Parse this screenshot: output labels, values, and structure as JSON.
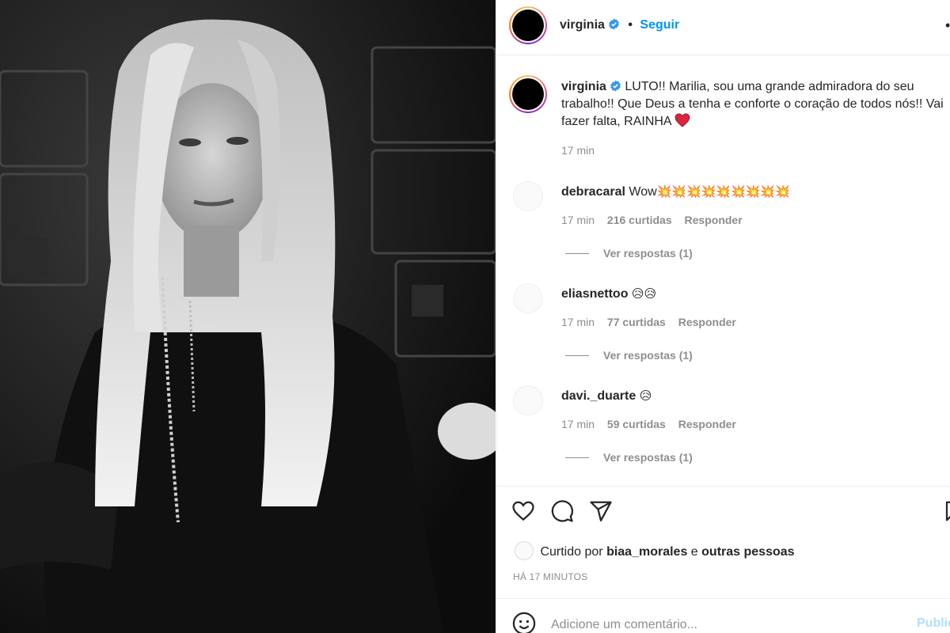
{
  "header": {
    "username": "virginia",
    "separator": "•",
    "follow_label": "Seguir",
    "more": "•"
  },
  "caption": {
    "username": "virginia",
    "text": "LUTO!! Marilia, sou uma grande admiradora do seu trabalho!! Que Deus a tenha e conforte o coração de todos nós!! Vai fazer falta, RAINHA",
    "emoji": "red-heart",
    "time": "17 min"
  },
  "comments": [
    {
      "username": "debracaral",
      "text": "Wow",
      "emoji": "💥💥💥💥💥💥💥💥💥",
      "time": "17 min",
      "likes": "216 curtidas",
      "reply_label": "Responder",
      "view_replies": "Ver respostas (1)"
    },
    {
      "username": "eliasnettoo",
      "text": "",
      "emoji": "😥😥",
      "time": "17 min",
      "likes": "77 curtidas",
      "reply_label": "Responder",
      "view_replies": "Ver respostas (1)"
    },
    {
      "username": "davi._duarte",
      "text": "",
      "emoji": "😥",
      "time": "17 min",
      "likes": "59 curtidas",
      "reply_label": "Responder",
      "view_replies": "Ver respostas (1)"
    }
  ],
  "likes": {
    "prefix": "Curtido por",
    "user": "biaa_morales",
    "conjunction": "e",
    "others": "outras pessoas"
  },
  "post_time": "HÁ 17 MINUTOS",
  "add_comment": {
    "placeholder": "Adicione um comentário...",
    "publish_label": "Publicar"
  },
  "colors": {
    "accent": "#0095f6",
    "verified": "#3897f0",
    "heart": "#e0245e",
    "muted": "#8e8e8e"
  },
  "icons": [
    "verified-badge-icon",
    "heart-icon",
    "comment-icon",
    "share-icon",
    "save-icon",
    "emoji-icon",
    "more-icon"
  ]
}
